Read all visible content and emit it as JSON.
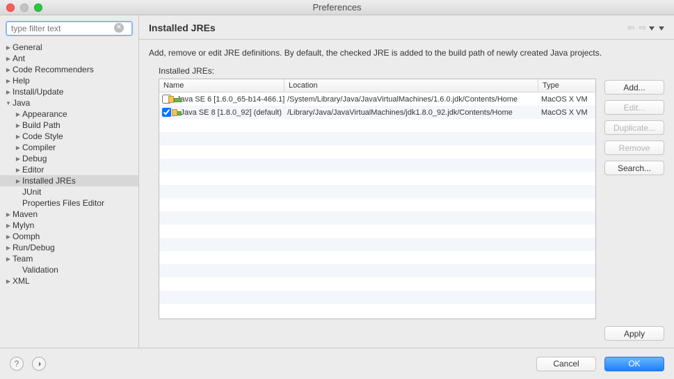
{
  "window": {
    "title": "Preferences"
  },
  "filter": {
    "placeholder": "type filter text"
  },
  "tree": [
    {
      "label": "General",
      "depth": 0,
      "arrow": "collapsed"
    },
    {
      "label": "Ant",
      "depth": 0,
      "arrow": "collapsed"
    },
    {
      "label": "Code Recommenders",
      "depth": 0,
      "arrow": "collapsed"
    },
    {
      "label": "Help",
      "depth": 0,
      "arrow": "collapsed"
    },
    {
      "label": "Install/Update",
      "depth": 0,
      "arrow": "collapsed"
    },
    {
      "label": "Java",
      "depth": 0,
      "arrow": "expanded"
    },
    {
      "label": "Appearance",
      "depth": 1,
      "arrow": "collapsed"
    },
    {
      "label": "Build Path",
      "depth": 1,
      "arrow": "collapsed"
    },
    {
      "label": "Code Style",
      "depth": 1,
      "arrow": "collapsed"
    },
    {
      "label": "Compiler",
      "depth": 1,
      "arrow": "collapsed"
    },
    {
      "label": "Debug",
      "depth": 1,
      "arrow": "collapsed"
    },
    {
      "label": "Editor",
      "depth": 1,
      "arrow": "collapsed"
    },
    {
      "label": "Installed JREs",
      "depth": 1,
      "arrow": "collapsed",
      "selected": true
    },
    {
      "label": "JUnit",
      "depth": 1,
      "arrow": "none"
    },
    {
      "label": "Properties Files Editor",
      "depth": 1,
      "arrow": "none"
    },
    {
      "label": "Maven",
      "depth": 0,
      "arrow": "collapsed"
    },
    {
      "label": "Mylyn",
      "depth": 0,
      "arrow": "collapsed"
    },
    {
      "label": "Oomph",
      "depth": 0,
      "arrow": "collapsed"
    },
    {
      "label": "Run/Debug",
      "depth": 0,
      "arrow": "collapsed"
    },
    {
      "label": "Team",
      "depth": 0,
      "arrow": "collapsed"
    },
    {
      "label": "Validation",
      "depth": 1,
      "arrow": "none"
    },
    {
      "label": "XML",
      "depth": 0,
      "arrow": "collapsed"
    }
  ],
  "page": {
    "title": "Installed JREs",
    "description": "Add, remove or edit JRE definitions. By default, the checked JRE is added to the build path of newly created Java projects.",
    "table_label": "Installed JREs:",
    "columns": {
      "name": "Name",
      "location": "Location",
      "type": "Type"
    },
    "rows": [
      {
        "checked": false,
        "bold": false,
        "name": "Java SE 6 [1.6.0_65-b14-466.1]",
        "location": "/System/Library/Java/JavaVirtualMachines/1.6.0.jdk/Contents/Home",
        "type": "MacOS X VM"
      },
      {
        "checked": true,
        "bold": true,
        "name": "Java SE 8 [1.8.0_92] (default)",
        "location": "/Library/Java/JavaVirtualMachines/jdk1.8.0_92.jdk/Contents/Home",
        "type": "MacOS X VM"
      }
    ]
  },
  "buttons": {
    "add": "Add...",
    "edit": "Edit...",
    "duplicate": "Duplicate...",
    "remove": "Remove",
    "search": "Search...",
    "apply": "Apply",
    "cancel": "Cancel",
    "ok": "OK"
  }
}
